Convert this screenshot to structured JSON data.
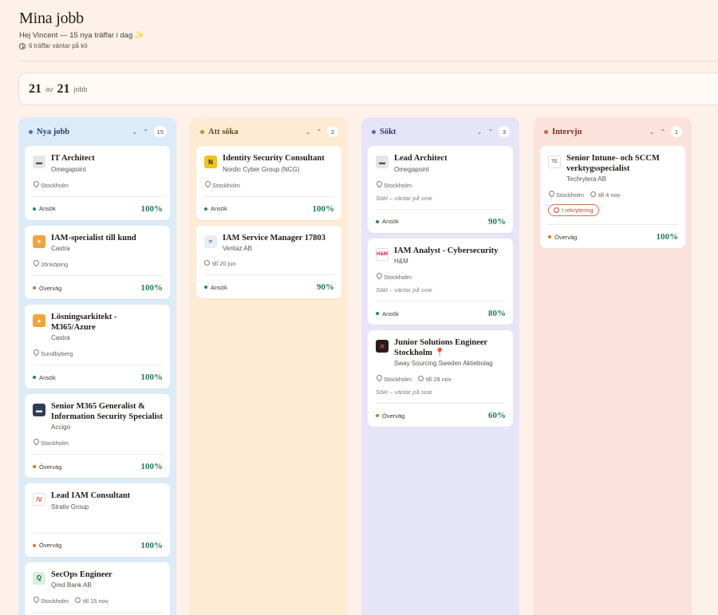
{
  "header": {
    "title": "Mina jobb",
    "subtitle": "Hej Vincent — 15 nya träffar i dag ✨",
    "queue": "6 träffar väntar på kö"
  },
  "counter": {
    "shown": "21",
    "of_label": "av",
    "total": "21",
    "unit": "jobb"
  },
  "colors": {
    "green": "#1d7a5a",
    "ansok": "#1f8a62",
    "overvag": "#d07a22"
  },
  "columns": [
    {
      "key": "nya",
      "title": "Nya jobb",
      "count": "15",
      "bg": "#dcebf8",
      "dot": "#3e72c4",
      "title_color": "#24406e",
      "cards": [
        {
          "title": "IT Architect",
          "company": "Omegapoint",
          "location": "Stockholm",
          "status": "Ansök",
          "status_color": "#1f8a62",
          "score": "100%",
          "logo": "omegapoint-logo"
        },
        {
          "title": "IAM-specialist till kund",
          "company": "Castra",
          "location": "Jönköping",
          "status": "Överväg",
          "status_color": "#d07a22",
          "score": "100%",
          "logo": "castra-logo"
        },
        {
          "title": "Lösningsarkitekt - M365/Azure",
          "company": "Castra",
          "location": "Sundbyberg",
          "status": "Ansök",
          "status_color": "#1f8a62",
          "score": "100%",
          "logo": "castra-logo"
        },
        {
          "title": "Senior M365 Generalist & Information Security Specialist",
          "company": "Accigo",
          "location": "Stockholm",
          "status": "Överväg",
          "status_color": "#d07a22",
          "score": "100%",
          "logo": "accigo-logo"
        },
        {
          "title": "Lead IAM Consultant",
          "company": "Strativ Group",
          "location": "",
          "status": "Överväg",
          "status_color": "#d07a22",
          "score": "100%",
          "logo": "strativ-logo"
        },
        {
          "title": "SecOps Engineer",
          "company": "Qred Bank AB",
          "location": "Stockholm",
          "deadline": "till 15 nov",
          "status": "",
          "score": "",
          "logo": "qred-logo"
        }
      ]
    },
    {
      "key": "att-soka",
      "title": "Att söka",
      "count": "2",
      "bg": "#fdebd3",
      "dot": "#d08a2a",
      "title_color": "#6a4a1a",
      "cards": [
        {
          "title": "Identity Security Consultant",
          "company": "Nordic Cyber Group (NCG)",
          "location": "Stockholm",
          "status": "Ansök",
          "status_color": "#1f8a62",
          "score": "100%",
          "logo": "ncg-logo"
        },
        {
          "title": "IAM Service Manager 17803",
          "company": "Veritaz AB",
          "deadline": "till 20 jun",
          "status": "Ansök",
          "status_color": "#1f8a62",
          "score": "90%",
          "logo": "veritaz-logo"
        }
      ]
    },
    {
      "key": "sokt",
      "title": "Sökt",
      "count": "3",
      "bg": "#e6e5f8",
      "dot": "#6a5cc4",
      "title_color": "#3b3170",
      "cards": [
        {
          "title": "Lead Architect",
          "company": "Omegapoint",
          "location": "Stockholm",
          "note": "Sökt – väntar på svar",
          "status": "Ansök",
          "status_color": "#1f8a62",
          "score": "90%",
          "logo": "omegapoint-logo"
        },
        {
          "title": "IAM Analyst - Cybersecurity",
          "company": "H&M",
          "location": "Stockholm",
          "note": "Sökt – väntar på svar",
          "status": "Ansök",
          "status_color": "#1f8a62",
          "score": "80%",
          "logo": "hm-logo"
        },
        {
          "title": "Junior Solutions Engineer Stockholm 📍",
          "company": "Sway Sourcing Sweden Aktiebolag",
          "location": "Stockholm",
          "deadline": "till 28 nov",
          "note": "Sökt – väntar på svar",
          "status": "Överväg",
          "status_color": "#d07a22",
          "score": "60%",
          "logo": "sway-logo"
        }
      ]
    },
    {
      "key": "intervju",
      "title": "Intervju",
      "count": "1",
      "bg": "#fbe3dc",
      "dot": "#d4604a",
      "title_color": "#7a2e20",
      "cards": [
        {
          "title": "Senior Intune- och SCCM verktygsspecialist",
          "company": "Techrytera AB",
          "location": "Stockholm",
          "deadline": "till 4 nov",
          "badge": "I rekrytering",
          "status": "Överväg",
          "status_color": "#d07a22",
          "score": "100%",
          "logo": "techrytera-logo",
          "logo_text": "TE"
        }
      ]
    }
  ]
}
